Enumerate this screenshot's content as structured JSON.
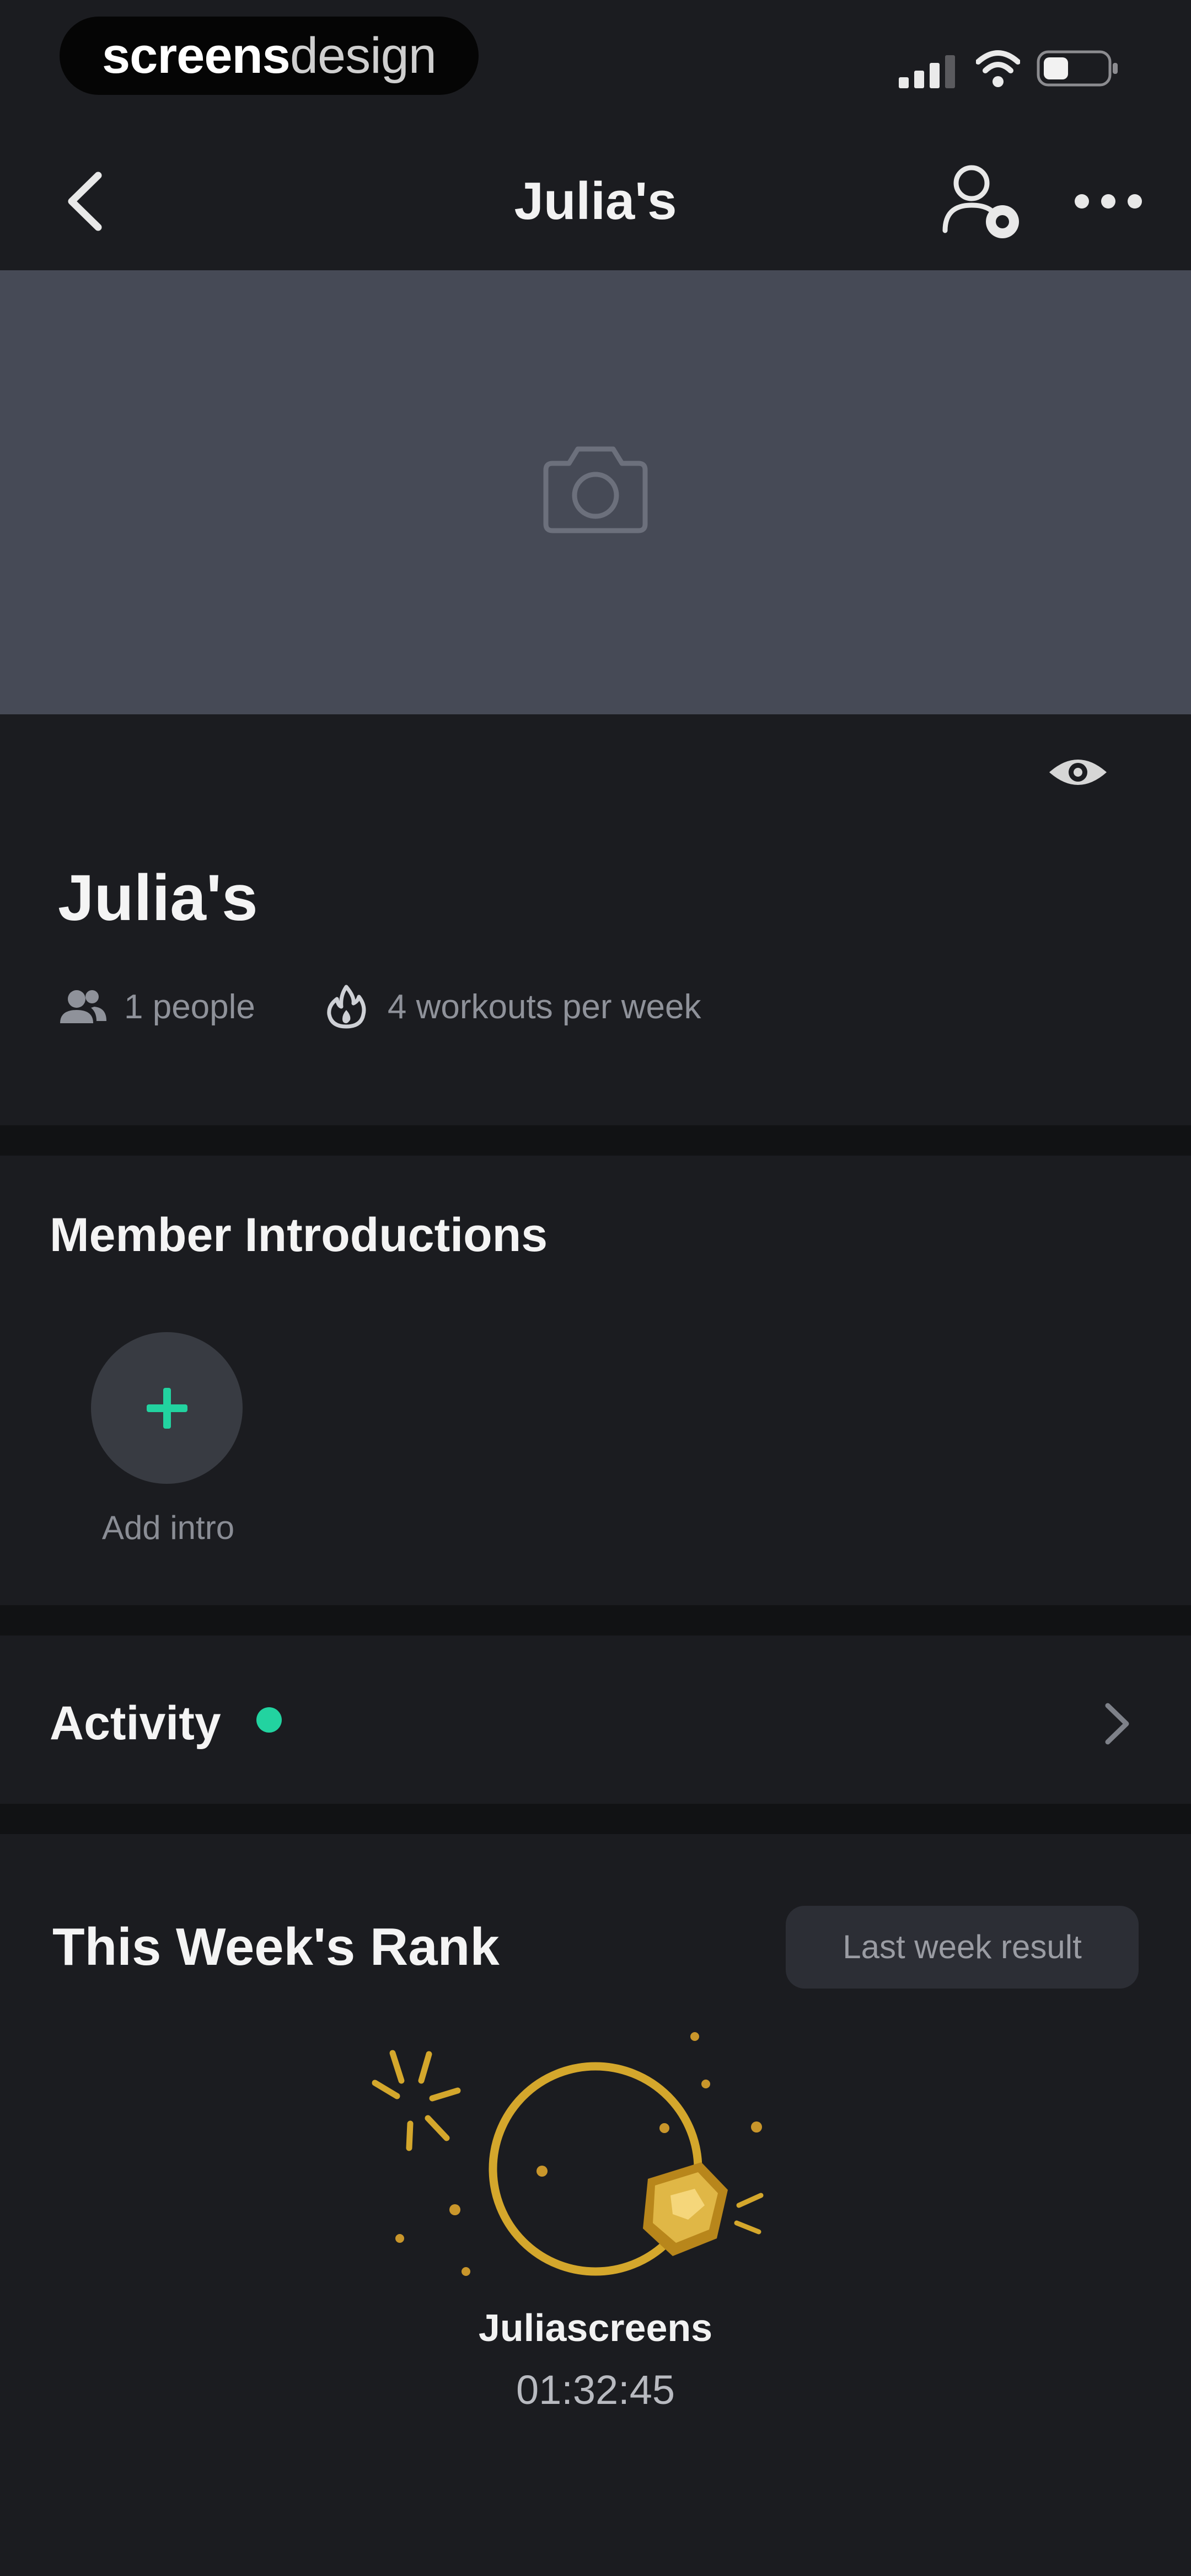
{
  "status_bar": {
    "brand_bold": "screens",
    "brand_light": "design",
    "icons": [
      "signal-icon",
      "wifi-icon",
      "battery-icon"
    ]
  },
  "nav": {
    "title": "Julia's",
    "icons": [
      "back-icon",
      "add-member-icon",
      "more-icon"
    ]
  },
  "cover": {
    "icon": "camera-icon",
    "background": "#464a56"
  },
  "group": {
    "name": "Julia's",
    "people": "1 people",
    "workouts": "4 workouts per week"
  },
  "introductions": {
    "title": "Member Introductions",
    "add_label": "Add intro",
    "add_icon": "plus-icon",
    "accent": "#22d3a0"
  },
  "activity": {
    "title": "Activity",
    "status_dot_color": "#22d3a0"
  },
  "rank": {
    "title": "This Week's Rank",
    "last_week_label": "Last week result",
    "winner_name": "Juliascreens",
    "winner_time": "01:32:45",
    "medal_color": "#d4a72c"
  }
}
